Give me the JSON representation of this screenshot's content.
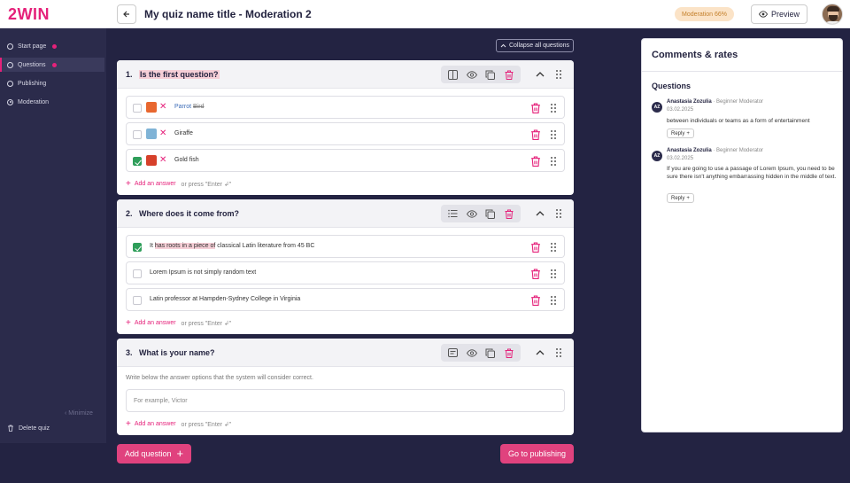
{
  "header": {
    "logo": "2WIN",
    "title": "My quiz name title - Moderation 2",
    "moderation_badge": "Moderation 66%",
    "preview_label": "Preview"
  },
  "sidebar": {
    "items": [
      {
        "label": "Start page",
        "badge": true,
        "active": false
      },
      {
        "label": "Questions",
        "badge": true,
        "active": true
      },
      {
        "label": "Publishing",
        "badge": false,
        "active": false
      },
      {
        "label": "Moderation",
        "badge": false,
        "active": false
      }
    ],
    "minimize_label": "Minimize",
    "delete_label": "Delete quiz"
  },
  "main": {
    "collapse_label": "Collapse all questions",
    "add_answer_label": "Add an answer",
    "add_answer_hint": "or press \"Enter ↲\"",
    "questions": [
      {
        "number": "1.",
        "title": "Is the first question?",
        "answers": [
          {
            "text": "Parrot",
            "strike": "Bird",
            "checked": false,
            "thumb_color": "#e8672f"
          },
          {
            "text": "Giraffe",
            "checked": false,
            "thumb_color": "#7fb3d6"
          },
          {
            "text": "Gold fish",
            "checked": true,
            "thumb_color": "#d6402a"
          }
        ]
      },
      {
        "number": "2.",
        "title": "Where does it come from?",
        "answers": [
          {
            "pre": "It ",
            "hl": "has roots in a piece of",
            "post": " classical Latin literature from 45 BC",
            "checked": true
          },
          {
            "text": "Lorem Ipsum is not simply random text",
            "checked": false
          },
          {
            "text": "Latin professor at Hampden-Sydney College in Virginia",
            "checked": false
          }
        ]
      },
      {
        "number": "3.",
        "title": "What is your name?",
        "description": "Write below the answer options that the system will consider correct.",
        "input_placeholder": "For example, Victor"
      }
    ],
    "add_question_label": "Add question",
    "publish_label": "Go to publishing"
  },
  "comments": {
    "title": "Comments & rates",
    "section": "Questions",
    "items": [
      {
        "initials": "AZ",
        "name": "Anastasia Zozulia",
        "role": "· Beginner Moderator",
        "date": "03.02.2025",
        "text": "between individuals or teams as a form of entertainment",
        "reply_label": "Reply"
      },
      {
        "initials": "AZ",
        "name": "Anastasia Zozulia",
        "role": "· Beginner Moderator",
        "date": "03.02.2025",
        "text": "If you are going to use a passage of Lorem Ipsum, you need to be sure there isn't anything embarrassing hidden in the middle of text.",
        "reply_label": "Reply"
      }
    ]
  },
  "colors": {
    "brand": "#e5217a",
    "button": "#e0427e",
    "sidebar_bg": "#2b2b4b",
    "page_bg": "#232342",
    "check_green": "#2f9e5a"
  }
}
